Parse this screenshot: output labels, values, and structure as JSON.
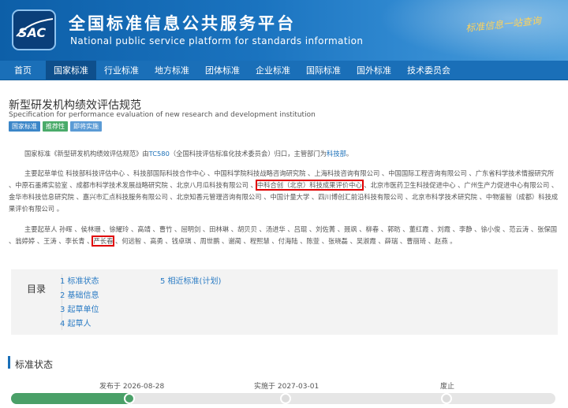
{
  "header": {
    "logo_text": "SAC",
    "title": "全国标准信息公共服务平台",
    "subtitle": "National public service platform  for standards information",
    "slogan": "标准信息一站查询"
  },
  "nav": {
    "items": [
      "首页",
      "国家标准",
      "行业标准",
      "地方标准",
      "团体标准",
      "企业标准",
      "国际标准",
      "国外标准",
      "技术委员会"
    ],
    "active_index": 1
  },
  "standard": {
    "title": "新型研发机构绩效评估规范",
    "title_en": "Specification for performance evaluation of new research and development institution",
    "tags": [
      "国家标准",
      "推荐性",
      "即将实施"
    ],
    "intro_a": "国家标准《新型研发机构绩效评估规范》由",
    "tc_link": "TC580",
    "intro_b": "（全国科技评估标准化技术委员会）归口，主管部门为",
    "dept_link": "科技部",
    "intro_c": "。",
    "units_a": "主要起草单位 科技部科技评估中心 、科技部国际科技合作中心 、中国科学院科技战略咨询研究院 、上海科技咨询有限公司 、中国国际工程咨询有限公司 、广东省科学技术情报研究所 、中原石墨烯实验室 、成都市科学技术发展战略研究院 、北京八月瓜科技有限公司 、",
    "units_highlight": "中科合创（北京）科技成果评价中心",
    "units_b": " 、北京市医药卫生科技促进中心 、广州生产力促进中心有限公司 、金华市科技信息研究院 、嘉兴市汇点科技服务有限公司 、北京知香元管理咨询有限公司 、中国计量大学 、四川博创汇前沿科技有限公司 、北京市科学技术研究院 、中物鉴智（成都）科技成果评价有限公司 。",
    "people_a": "主要起草人 孙晖 、侯林珊 、徐耀玲 、高靖 、曹竹 、屈明剑 、田林琳 、胡贝贝 、汤进华 、吕琨 、刘佐菁 、聂飒 、柳春 、郭昉 、董红霞 、刘霞 、李静 、徐小俊 、范云涛 、张保国 、翁婷婷 、王涛 、李长青 、",
    "people_highlight": "严长春",
    "people_b": " 、何远智 、高勇 、钱卓琪 、周世鹏 、谢蔺 、程熙慧 、付海陆 、陈萱 、张晓磊 、吴淑霞 、薛瑞 、曹丽琦 、赵燕 。"
  },
  "toc": {
    "label": "目录",
    "links": [
      "1 标准状态",
      "2 基础信息",
      "3 起草单位",
      "4 起草人",
      "5 相近标准(计划)"
    ]
  },
  "status": {
    "title": "标准状态",
    "steps": [
      {
        "label": "发布于 2026-08-28",
        "done": true
      },
      {
        "label": "实施于 2027-03-01",
        "done": false
      },
      {
        "label": "废止",
        "done": false
      }
    ],
    "progress": 0.22,
    "colors": {
      "done": "#4aa068",
      "track": "#e6e6e6"
    }
  }
}
